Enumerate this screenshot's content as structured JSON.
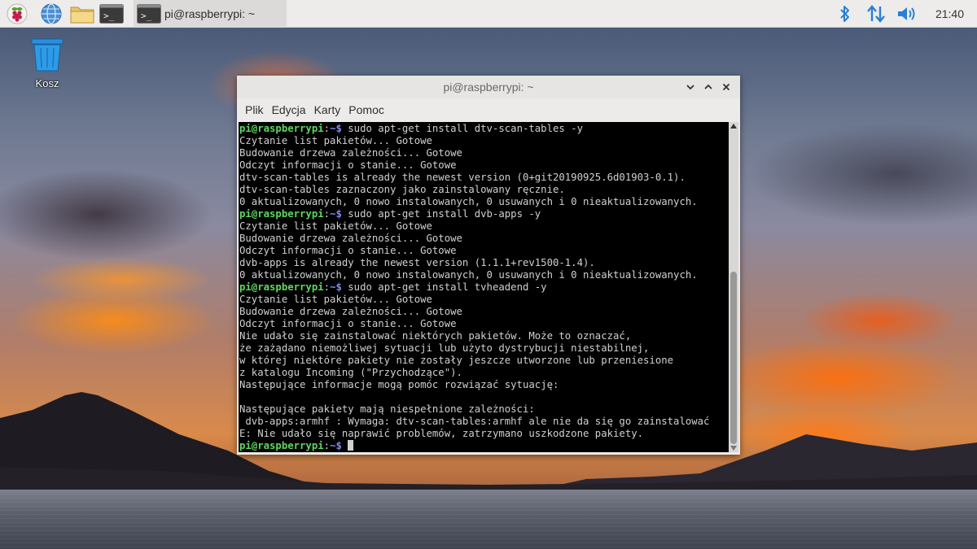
{
  "panel": {
    "task_button_label": "pi@raspberrypi: ~",
    "clock": "21:40",
    "launchers": [
      "raspberry-menu-icon",
      "web-browser-icon",
      "file-manager-icon",
      "terminal-icon"
    ],
    "tray": [
      "bluetooth-icon",
      "network-icon",
      "volume-icon"
    ]
  },
  "desktop": {
    "trash_label": "Kosz"
  },
  "window": {
    "title": "pi@raspberrypi: ~",
    "menu": [
      "Plik",
      "Edycja",
      "Karty",
      "Pomoc"
    ],
    "scroll_fraction": 0.55
  },
  "colors": {
    "prompt_user": "#5fd75f",
    "prompt_path": "#7f8cf0",
    "terminal_bg": "#000000",
    "terminal_fg": "#d0d0d0"
  },
  "terminal": {
    "prompt_user": "pi@raspberrypi",
    "prompt_sep": ":",
    "prompt_path": "~",
    "prompt_dollar": "$",
    "lines": [
      {
        "type": "cmd",
        "text": " sudo apt-get install dtv-scan-tables -y"
      },
      {
        "type": "out",
        "text": "Czytanie list pakietów... Gotowe"
      },
      {
        "type": "out",
        "text": "Budowanie drzewa zależności... Gotowe"
      },
      {
        "type": "out",
        "text": "Odczyt informacji o stanie... Gotowe"
      },
      {
        "type": "out",
        "text": "dtv-scan-tables is already the newest version (0+git20190925.6d01903-0.1)."
      },
      {
        "type": "out",
        "text": "dtv-scan-tables zaznaczony jako zainstalowany ręcznie."
      },
      {
        "type": "out",
        "text": "0 aktualizowanych, 0 nowo instalowanych, 0 usuwanych i 0 nieaktualizowanych."
      },
      {
        "type": "cmd",
        "text": " sudo apt-get install dvb-apps -y"
      },
      {
        "type": "out",
        "text": "Czytanie list pakietów... Gotowe"
      },
      {
        "type": "out",
        "text": "Budowanie drzewa zależności... Gotowe"
      },
      {
        "type": "out",
        "text": "Odczyt informacji o stanie... Gotowe"
      },
      {
        "type": "out",
        "text": "dvb-apps is already the newest version (1.1.1+rev1500-1.4)."
      },
      {
        "type": "out",
        "text": "0 aktualizowanych, 0 nowo instalowanych, 0 usuwanych i 0 nieaktualizowanych."
      },
      {
        "type": "cmd",
        "text": " sudo apt-get install tvheadend -y"
      },
      {
        "type": "out",
        "text": "Czytanie list pakietów... Gotowe"
      },
      {
        "type": "out",
        "text": "Budowanie drzewa zależności... Gotowe"
      },
      {
        "type": "out",
        "text": "Odczyt informacji o stanie... Gotowe"
      },
      {
        "type": "out",
        "text": "Nie udało się zainstalować niektórych pakietów. Może to oznaczać,"
      },
      {
        "type": "out",
        "text": "że zażądano niemożliwej sytuacji lub użyto dystrybucji niestabilnej,"
      },
      {
        "type": "out",
        "text": "w której niektóre pakiety nie zostały jeszcze utworzone lub przeniesione"
      },
      {
        "type": "out",
        "text": "z katalogu Incoming (\"Przychodzące\")."
      },
      {
        "type": "out",
        "text": "Następujące informacje mogą pomóc rozwiązać sytuację:"
      },
      {
        "type": "out",
        "text": ""
      },
      {
        "type": "out",
        "text": "Następujące pakiety mają niespełnione zależności:"
      },
      {
        "type": "out",
        "text": " dvb-apps:armhf : Wymaga: dtv-scan-tables:armhf ale nie da się go zainstalować"
      },
      {
        "type": "out",
        "text": "E: Nie udało się naprawić problemów, zatrzymano uszkodzone pakiety."
      },
      {
        "type": "cmd",
        "text": " ",
        "cursor": true
      }
    ]
  }
}
